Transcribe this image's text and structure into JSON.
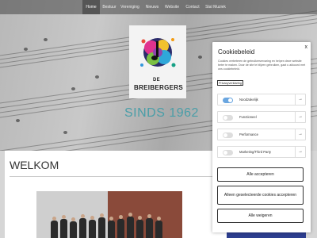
{
  "nav": {
    "items": [
      {
        "label": "Home",
        "active": true
      },
      {
        "label": "Bestuur"
      },
      {
        "label": "Vereniging"
      },
      {
        "label": "Nieuws"
      },
      {
        "label": "Website"
      },
      {
        "label": "Contact"
      },
      {
        "label": "Stal Muziek"
      }
    ]
  },
  "logo": {
    "line1": "DE",
    "line2": "BREIBERGERS"
  },
  "hero": {
    "tagline": "SINDS 1962"
  },
  "main": {
    "heading": "WELKOM"
  },
  "cookie": {
    "close": "x",
    "title": "Cookiebeleid",
    "text": "Cookies verbeteren de gebruikerservaring en helpen deze website beter te maken. Door de site te blijven gebruiken, gaat u akkoord met ons cookiebeleid.",
    "link": "Privacyverklaring",
    "categories": [
      {
        "label": "Noodzakelijk",
        "enabled": true
      },
      {
        "label": "Functioneel",
        "enabled": false
      },
      {
        "label": "Performance",
        "enabled": false
      },
      {
        "label": "Marketing/Third Party",
        "enabled": false
      }
    ],
    "arrow": "→",
    "accept_all": "Alle accepteren",
    "accept_selected": "Alleen geselecteerde cookies accepteren",
    "reject_all": "Alle weigeren"
  },
  "colors": {
    "accent": "#4a9ea8",
    "toggle_on": "#6aa6e0"
  }
}
